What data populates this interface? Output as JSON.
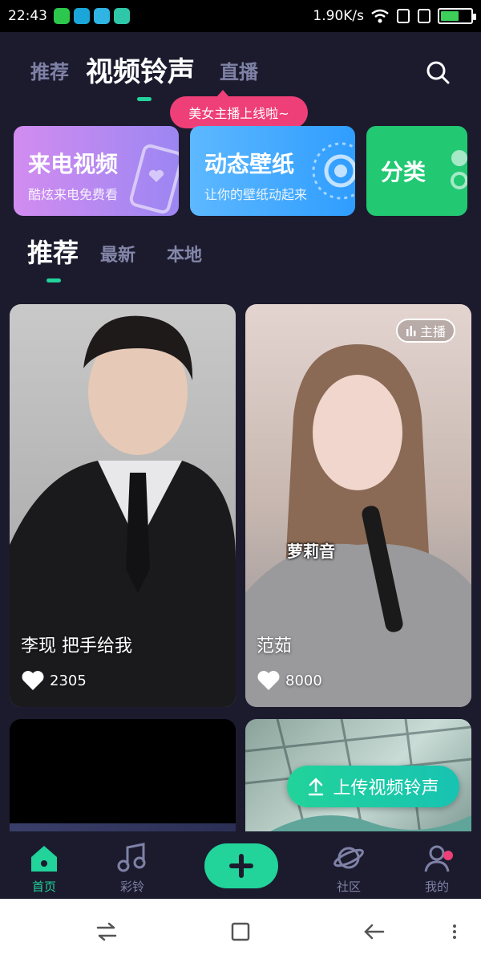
{
  "status_bar": {
    "time": "22:43",
    "network_speed": "1.90K/s",
    "app_icons": [
      "#2cc84d",
      "#1aa6d8",
      "#2fb4e4",
      "#2ec7a8"
    ],
    "battery_level": 0.62
  },
  "top_tabs": {
    "items": [
      {
        "label": "推荐",
        "active": false
      },
      {
        "label": "视频铃声",
        "active": true
      },
      {
        "label": "直播",
        "active": false
      }
    ],
    "search_icon": "search-icon"
  },
  "live_bubble": "美女主播上线啦~",
  "categories": [
    {
      "title": "来电视频",
      "subtitle": "酷炫来电免费看"
    },
    {
      "title": "动态壁纸",
      "subtitle": "让你的壁纸动起来"
    },
    {
      "title": "分类",
      "subtitle": ""
    }
  ],
  "sub_tabs": [
    "推荐",
    "最新",
    "本地"
  ],
  "videos": [
    {
      "name": "李现 把手给我",
      "likes": "2305",
      "live": false
    },
    {
      "name": "范茹",
      "likes": "8000",
      "live": true,
      "live_label": "主播",
      "overlay_text": "萝莉音"
    }
  ],
  "upload_button": "上传视频铃声",
  "bottom_nav": [
    {
      "label": "首页",
      "icon": "home-icon",
      "active": true
    },
    {
      "label": "彩铃",
      "icon": "music-note-icon",
      "active": false
    },
    {
      "label": "",
      "icon": "plus-icon",
      "active": false
    },
    {
      "label": "社区",
      "icon": "planet-icon",
      "active": false
    },
    {
      "label": "我的",
      "icon": "user-icon",
      "active": false
    }
  ],
  "colors": {
    "background": "#1c1b2e",
    "accent": "#22d39a",
    "live_pink": "#ef3f78",
    "inactive_text": "#7f82a6"
  }
}
